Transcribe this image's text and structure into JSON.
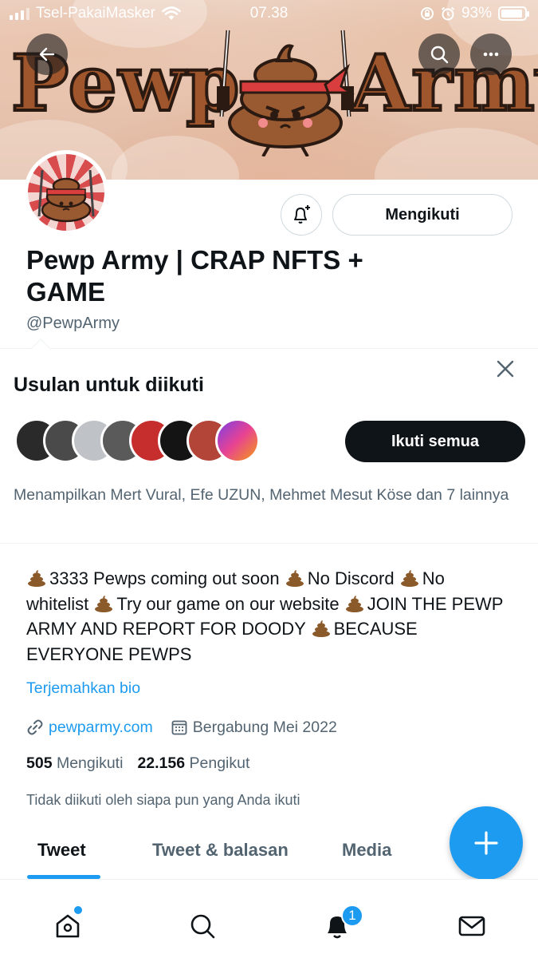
{
  "status_bar": {
    "carrier": "Tsel-PakaiMasker",
    "time": "07.38",
    "battery": "93%",
    "battery_level": 0.93
  },
  "banner": {
    "text_left": "Pewp",
    "text_right": "Army"
  },
  "profile": {
    "display_name": "Pewp Army | CRAP NFTS + GAME",
    "handle": "@PewpArmy",
    "follow_button_label": "Mengikuti"
  },
  "suggestions": {
    "title": "Usulan untuk diikuti",
    "follow_all_label": "Ikuti semua",
    "description": "Menampilkan Mert Vural, Efe UZUN, Mehmet Mesut Köse dan 7 lainnya"
  },
  "bio": {
    "segments": [
      "3333 Pewps coming out soon",
      "No Discord",
      "No whitelist",
      "Try our game on our website",
      "JOIN THE PEWP ARMY AND REPORT FOR DOODY",
      "BECAUSE EVERYONE PEWPS"
    ],
    "translate_label": "Terjemahkan bio",
    "website": "pewparmy.com",
    "joined": "Bergabung Mei 2022"
  },
  "stats": {
    "following_count": "505",
    "following_label": "Mengikuti",
    "followers_count": "22.156",
    "followers_label": "Pengikut",
    "not_followed_text": "Tidak diikuti oleh siapa pun yang Anda ikuti"
  },
  "tabs": [
    {
      "label": "Tweet",
      "active": true
    },
    {
      "label": "Tweet & balasan",
      "active": false
    },
    {
      "label": "Media",
      "active": false
    }
  ],
  "bottom_nav": {
    "items": [
      "home-icon",
      "search-icon",
      "notifications-icon",
      "messages-icon"
    ],
    "notification_badge": "1"
  },
  "colors": {
    "accent": "#1d9bf0",
    "text_primary": "#0f1419",
    "text_secondary": "#536471",
    "banner_brown": "#a0562c"
  }
}
